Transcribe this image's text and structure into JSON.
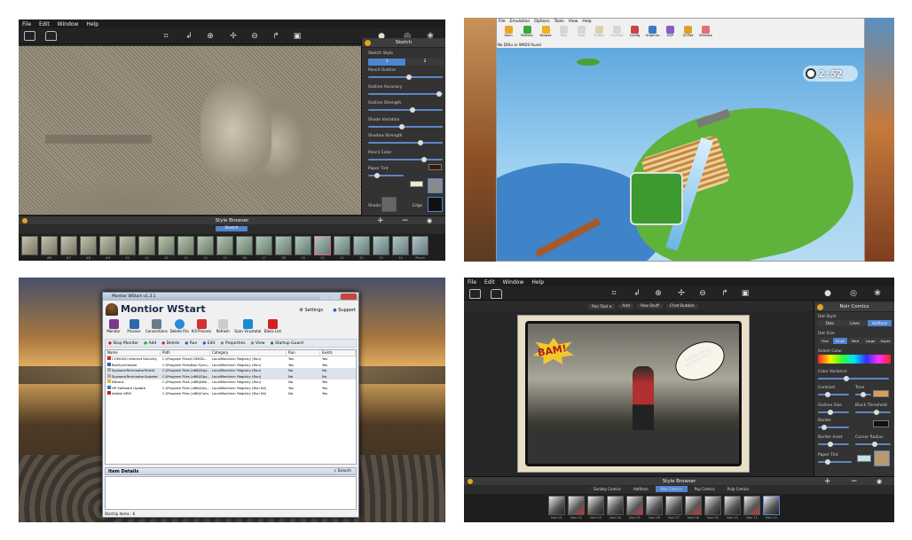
{
  "tl": {
    "menu": [
      "File",
      "Edit",
      "Window",
      "Help"
    ],
    "panel_title": "Sketch",
    "sketch_style_label": "Sketch Style",
    "style_tabs": [
      "1",
      "2"
    ],
    "controls": [
      {
        "label": "Pencil Outline",
        "value": 0.55
      },
      {
        "label": "Outline Accuracy",
        "value": 0.95
      },
      {
        "label": "Outline Strength",
        "value": 0.6
      },
      {
        "label": "Shade Variation",
        "value": 0.45
      },
      {
        "label": "Shadow Strength",
        "value": 0.7
      },
      {
        "label": "Pencil Color",
        "value": 0.75
      },
      {
        "label": "Paper Tint",
        "value": 0.25
      }
    ],
    "shade_label": "Shade",
    "edge_label": "Edge",
    "style_browser": "Style Browser",
    "browser_tab": "Sketch",
    "thumb_labels": [
      "",
      "#6",
      "#7",
      "#8",
      "#9",
      "10",
      "11",
      "12",
      "13",
      "14",
      "15",
      "16",
      "17",
      "18",
      "19",
      "20",
      "21",
      "22",
      "23",
      "24",
      "Pencil"
    ]
  },
  "tr": {
    "menu": [
      "File",
      "Emulation",
      "Options",
      "Tools",
      "View",
      "Help"
    ],
    "toolbar": [
      "Open",
      "Refresh",
      "Browse",
      "Play",
      "Stop",
      "FullScr",
      "ScrShot",
      "Config",
      "Graphics",
      "DSP",
      "GCPad",
      "Wiimote"
    ],
    "status": "No DOLs or WADS found",
    "timer": "2:52",
    "colors": {
      "sky": "#6ab6e6",
      "grass": "#5fb33b",
      "water": "#3f83c9"
    }
  },
  "bl": {
    "title_bar": "Montior WStart v1.3.1",
    "app_name": "Montior WStart",
    "settings": "Settings",
    "support": "Support",
    "toolbar": [
      "Monitor",
      "Process",
      "Connections",
      "Delete File",
      "Kill Process",
      "Refresh",
      "Scan Virustotal",
      "Block List"
    ],
    "actions": [
      "Stop Monitor",
      "Add",
      "Delete",
      "Run",
      "Edit",
      "Properties",
      "View",
      "Startup Guard"
    ],
    "columns": [
      "Name",
      "Path",
      "Category",
      "Run",
      "Exists"
    ],
    "rows": [
      {
        "name": "COMODO Internet Security",
        "path": "C:\\Program Files\\COMOD...",
        "category": "LocalMachine: Registry (Run)",
        "run": "Yes",
        "exists": "Yes"
      },
      {
        "name": "BoxSyncHelper",
        "path": "C:\\Program Files\\Box Sync\\...",
        "category": "LocalMachine: Registry (Run)",
        "run": "Yes",
        "exists": "Yes"
      },
      {
        "name": "SpywareTerminatorShield",
        "path": "C:\\Program Files (x86)\\Spy...",
        "category": "LocalMachine: Registry (Run)",
        "run": "No",
        "exists": "No"
      },
      {
        "name": "SpywareTerminatorUpdater",
        "path": "C:\\Program Files (x86)\\Spy...",
        "category": "LocalMachine: Registry (Run)",
        "run": "No",
        "exists": "No"
      },
      {
        "name": "Nitrous",
        "path": "C:\\Program Files (x86)\\NW...",
        "category": "LocalMachine: Registry (Run)",
        "run": "No",
        "exists": "Yes"
      },
      {
        "name": "HP Software Update",
        "path": "C:\\Program Files (x86)\\Hp\\...",
        "category": "LocalMachine: Registry (Run 64)",
        "run": "Yes",
        "exists": "Yes"
      },
      {
        "name": "Adobe ARM",
        "path": "C:\\Program Files (x86)\\Com...",
        "category": "LocalMachine: Registry (Run 64)",
        "run": "No",
        "exists": "Yes"
      }
    ],
    "item_details": "Item Details",
    "search": "Search",
    "status": "StartUp Items : 6"
  },
  "br": {
    "menu": [
      "File",
      "Edit",
      "Window",
      "Help"
    ],
    "topbar": [
      "Pan Tool",
      "Add",
      "Pow Stuff",
      "Chat Bubble"
    ],
    "panel_title": "Noir Comics",
    "dot_style_label": "Dot Style",
    "dot_style_tabs": [
      "Dots",
      "Lines",
      "Halftone"
    ],
    "dot_size_label": "Dot Size",
    "dot_size_tabs": [
      "Fine",
      "Small",
      "Med",
      "Large",
      "Super"
    ],
    "select_color": "Select Color",
    "controls": [
      {
        "label": "Color Variance",
        "value": 0.4
      },
      {
        "label": "Contrast",
        "value": 0.3
      },
      {
        "label": "Tone",
        "value": 0.5
      },
      {
        "label": "Outline Size",
        "value": 0.4
      },
      {
        "label": "Black Threshold",
        "value": 0.6
      },
      {
        "label": "Border",
        "value": 0.2
      },
      {
        "label": "Border Inset",
        "value": 0.4
      },
      {
        "label": "Corner Radius",
        "value": 0.55
      },
      {
        "label": "Paper Tint",
        "value": 0.3
      }
    ],
    "bam": "BAM!",
    "bubble": "Useless! Does anybody care?",
    "style_browser": "Style Browser",
    "browser_tabs": [
      "Sunday Comics",
      "Halftone",
      "Noir Comics",
      "Pop Comics",
      "Pulp Comics"
    ],
    "thumb_labels": [
      "Noir 01",
      "Noir 02",
      "Noir 03",
      "Noir 04",
      "Noir 05",
      "Noir 06",
      "Noir 07",
      "Noir 08",
      "Noir 09",
      "Noir 10",
      "Noir 11",
      "Noir 12"
    ]
  }
}
